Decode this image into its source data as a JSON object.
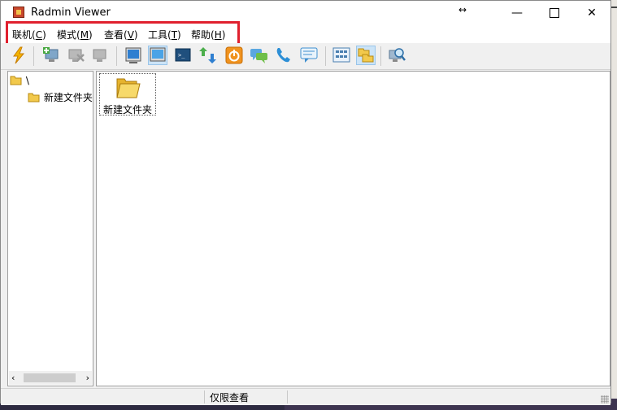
{
  "window": {
    "title": "Radmin Viewer",
    "resize_glyph": "↔",
    "close_glyph": "✕",
    "minimize_glyph": "—"
  },
  "menu": [
    {
      "label": "联机(",
      "key": "C",
      "tail": ")"
    },
    {
      "label": "模式(",
      "key": "M",
      "tail": ")"
    },
    {
      "label": "查看(",
      "key": "V",
      "tail": ")"
    },
    {
      "label": "工具(",
      "key": "T",
      "tail": ")"
    },
    {
      "label": "帮助(",
      "key": "H",
      "tail": ")"
    }
  ],
  "toolbar": {
    "icons": [
      "connect-icon",
      "add-computer-icon",
      "remove-computer-icon",
      "computer-properties-icon",
      "full-control-icon",
      "view-only-icon",
      "telnet-icon",
      "file-transfer-icon",
      "shutdown-icon",
      "text-chat-icon",
      "voice-chat-icon",
      "send-message-icon",
      "large-icons-view-icon",
      "folder-view-icon",
      "search-icon"
    ]
  },
  "tree": {
    "root": "\\",
    "child": "新建文件夹"
  },
  "pane": {
    "item_label": "新建文件夹"
  },
  "status": {
    "text": "仅限查看"
  },
  "colors": {
    "highlight": "#e0202e",
    "folder": "#f2c94c",
    "pressed": "#cce4f7"
  }
}
